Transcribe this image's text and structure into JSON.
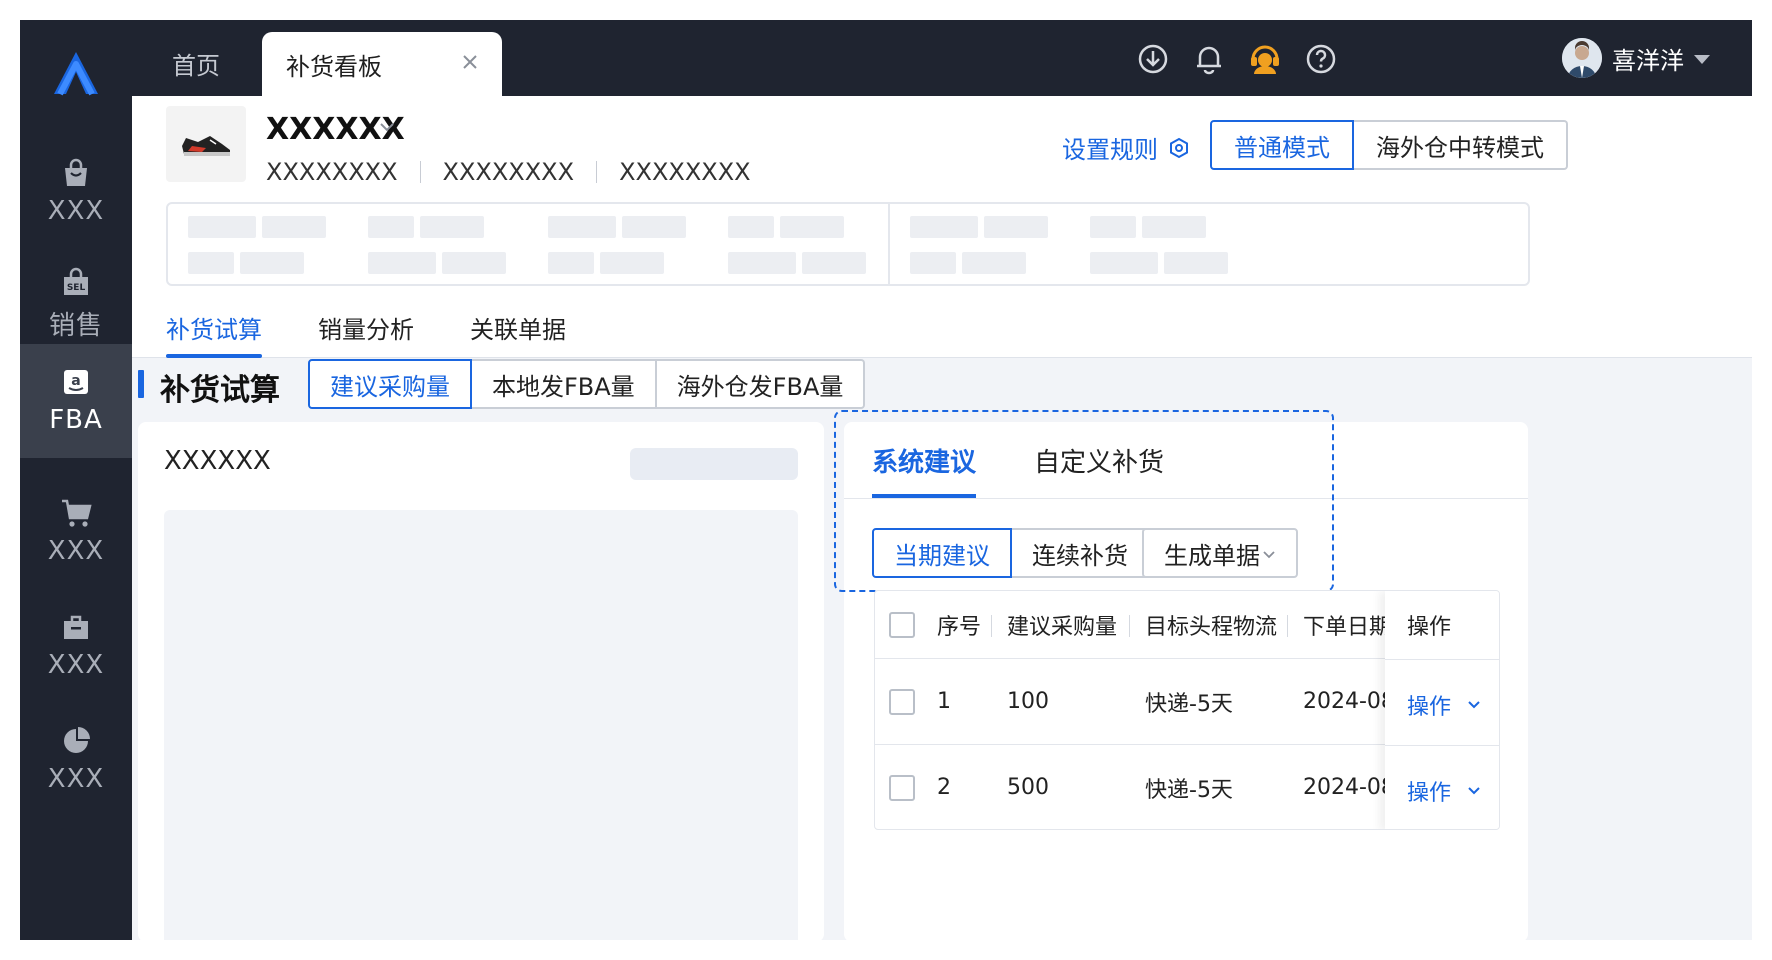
{
  "sidebar": {
    "items": [
      {
        "label": "XXX",
        "icon": "shopping-bag-icon"
      },
      {
        "label": "销售",
        "icon": "sel-bag-icon"
      },
      {
        "label": "FBA",
        "icon": "amazon-icon"
      },
      {
        "label": "XXX",
        "icon": "cart-icon"
      },
      {
        "label": "XXX",
        "icon": "briefcase-icon"
      },
      {
        "label": "XXX",
        "icon": "pie-chart-icon"
      }
    ],
    "active_index": 2
  },
  "topbar": {
    "tabs": [
      {
        "label": "首页"
      },
      {
        "label": "补货看板",
        "active": true
      }
    ],
    "user_name": "喜洋洋"
  },
  "product": {
    "title": "XXXXXX",
    "meta": [
      "XXXXXXXX",
      "XXXXXXXX",
      "XXXXXXXX"
    ],
    "rule_link": "设置规则",
    "modes": [
      "普通模式",
      "海外仓中转模式"
    ]
  },
  "subtabs": [
    "补货试算",
    "销量分析",
    "关联单据"
  ],
  "section": {
    "title": "补货试算",
    "segments": [
      "建议采购量",
      "本地发FBA量",
      "海外仓发FBA量"
    ]
  },
  "left_card": {
    "title": "XXXXXX"
  },
  "right_card": {
    "tabs": [
      "系统建议",
      "自定义补货"
    ],
    "segments": [
      "当期建议",
      "连续补货"
    ],
    "generate_label": "生成单据",
    "table": {
      "headers": [
        "序号",
        "建议采购量",
        "目标头程物流",
        "下单日期",
        "操作"
      ],
      "rows": [
        {
          "index": "1",
          "qty": "100",
          "logistics": "快递-5天",
          "date": "2024-08",
          "action": "操作"
        },
        {
          "index": "2",
          "qty": "500",
          "logistics": "快递-5天",
          "date": "2024-08",
          "action": "操作"
        }
      ]
    }
  },
  "colors": {
    "accent": "#1a66e0",
    "rail_bg": "#1f2430",
    "rail_active": "#3a404c",
    "page_bg": "#f2f4f8",
    "support_icon": "#f0a020"
  }
}
